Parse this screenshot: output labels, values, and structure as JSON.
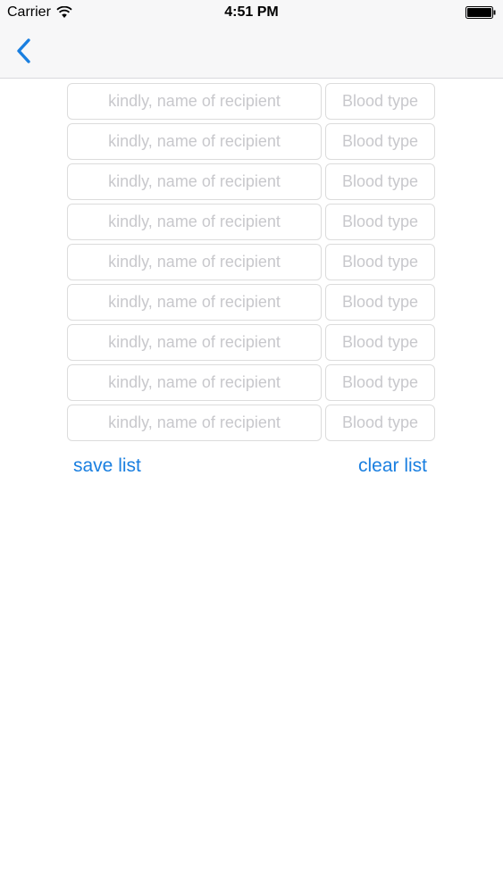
{
  "status_bar": {
    "carrier": "Carrier",
    "time": "4:51 PM"
  },
  "nav": {
    "back_icon": "chevron-left-icon",
    "accent_color": "#1a7fe0"
  },
  "recipients": [
    {
      "name_placeholder": "kindly, name of recipient",
      "blood_placeholder": "Blood type"
    },
    {
      "name_placeholder": "kindly, name of recipient",
      "blood_placeholder": "Blood type"
    },
    {
      "name_placeholder": "kindly, name of recipient",
      "blood_placeholder": "Blood type"
    },
    {
      "name_placeholder": "kindly, name of recipient",
      "blood_placeholder": "Blood type"
    },
    {
      "name_placeholder": "kindly, name of recipient",
      "blood_placeholder": "Blood type"
    },
    {
      "name_placeholder": "kindly, name of recipient",
      "blood_placeholder": "Blood type"
    },
    {
      "name_placeholder": "kindly, name of recipient",
      "blood_placeholder": "Blood type"
    },
    {
      "name_placeholder": "kindly, name of recipient",
      "blood_placeholder": "Blood type"
    },
    {
      "name_placeholder": "kindly, name of recipient",
      "blood_placeholder": "Blood type"
    }
  ],
  "actions": {
    "save_label": "save list",
    "clear_label": "clear list"
  }
}
